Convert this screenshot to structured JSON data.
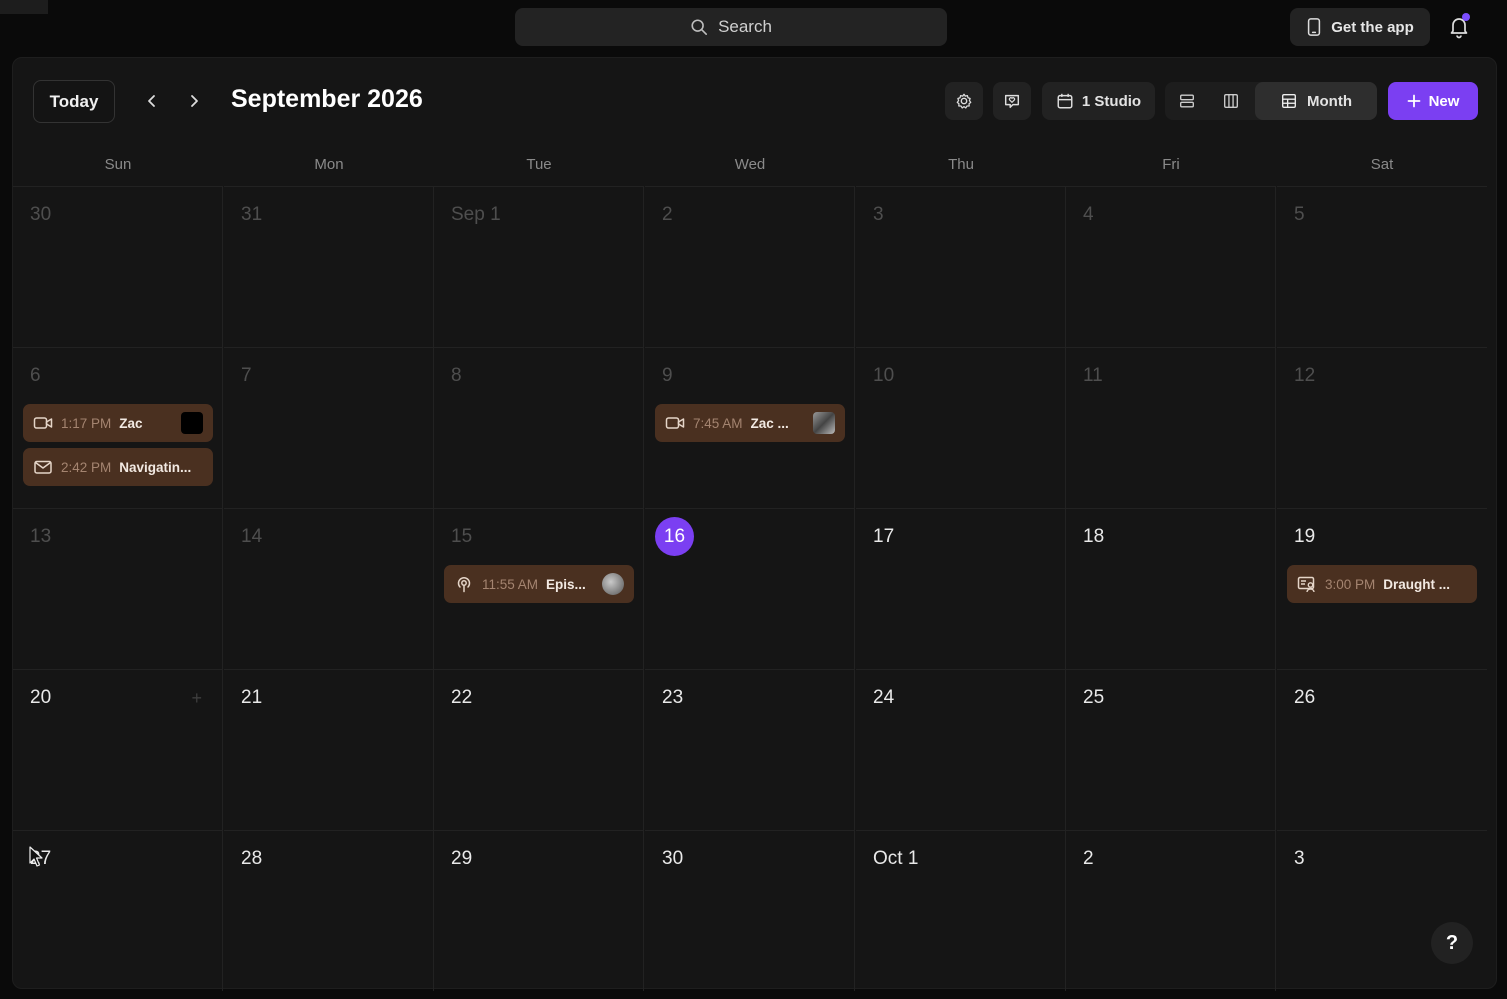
{
  "topbar": {
    "search_label": "Search",
    "get_app_label": "Get the app"
  },
  "toolbar": {
    "today_label": "Today",
    "month_title": "September 2026",
    "studio_label": "1 Studio",
    "month_view_label": "Month",
    "new_label": "New"
  },
  "weekdays": [
    "Sun",
    "Mon",
    "Tue",
    "Wed",
    "Thu",
    "Fri",
    "Sat"
  ],
  "weeks": [
    [
      "30",
      "31",
      "Sep 1",
      "2",
      "3",
      "4",
      "5"
    ],
    [
      "6",
      "7",
      "8",
      "9",
      "10",
      "11",
      "12"
    ],
    [
      "13",
      "14",
      "15",
      "16",
      "17",
      "18",
      "19"
    ],
    [
      "20",
      "21",
      "22",
      "23",
      "24",
      "25",
      "26"
    ],
    [
      "27",
      "28",
      "29",
      "30",
      "Oct 1",
      "2",
      "3"
    ]
  ],
  "today": "16",
  "events": {
    "sun6_a": {
      "time": "1:17 PM",
      "title": "Zac",
      "icon": "video-icon"
    },
    "sun6_b": {
      "time": "2:42 PM",
      "title": "Navigatin...",
      "icon": "mail-icon"
    },
    "wed9": {
      "time": "7:45 AM",
      "title": "Zac ...",
      "icon": "video-icon"
    },
    "tue15": {
      "time": "11:55 AM",
      "title": "Epis...",
      "icon": "podcast-icon"
    },
    "sat19": {
      "time": "3:00 PM",
      "title": "Draught ...",
      "icon": "screen-user-icon"
    }
  },
  "help_label": "?",
  "add_label": "+",
  "colors": {
    "accent": "#7b3ff2",
    "event_bg": "#4a3020",
    "panel_bg": "#151515"
  }
}
